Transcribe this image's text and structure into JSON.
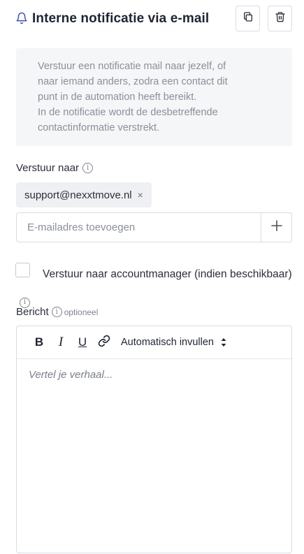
{
  "header": {
    "title": "Interne notificatie via e-mail"
  },
  "info": {
    "line1": "Verstuur een notificatie mail naar jezelf, of",
    "line2": "naar iemand anders, zodra een contact dit",
    "line3": "punt in de automation heeft bereikt.",
    "line4": "In de notificatie wordt de desbetreffende",
    "line5": "contactinformatie verstrekt."
  },
  "recipients": {
    "label": "Verstuur naar",
    "chips": [
      "support@nexxtmove.nl"
    ],
    "remove_glyph": "×",
    "input_placeholder": "E-mailadres toevoegen",
    "add_glyph": "+"
  },
  "account_manager": {
    "label_line1": "Verstuur naar accountmanager (indien",
    "label_line2": "beschikbaar)",
    "checked": false
  },
  "message": {
    "label": "Bericht",
    "optional": "optioneel",
    "toolbar": {
      "bold": "B",
      "italic": "I",
      "underline": "U",
      "autofill": "Automatisch invullen"
    },
    "placeholder": "Vertel je verhaal..."
  },
  "icons": {
    "title": "bell-icon",
    "duplicate": "copy-icon",
    "delete": "trash-icon",
    "info": "info-icon",
    "link": "link-icon"
  },
  "colors": {
    "accent": "#3f51c3",
    "border": "#d9dce2",
    "info_bg": "#f5f6f8"
  }
}
